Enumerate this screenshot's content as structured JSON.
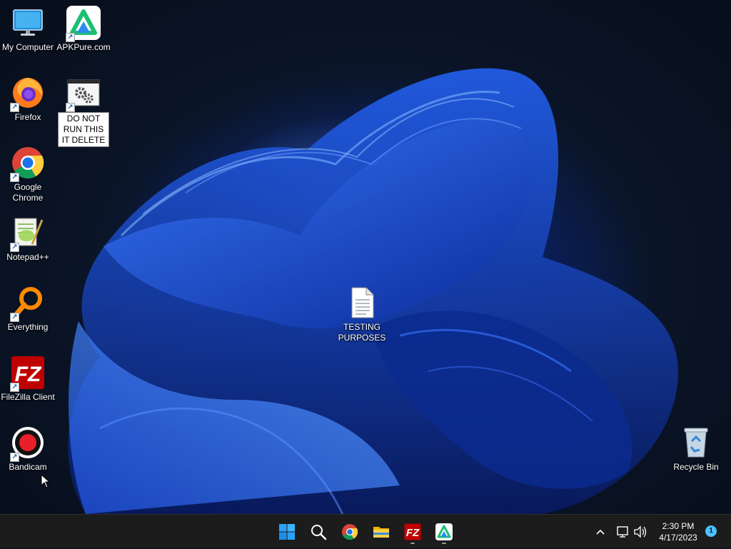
{
  "desktop": {
    "icons": {
      "my_computer": {
        "label": "My Computer",
        "icon": "monitor-icon"
      },
      "apkpure": {
        "label": "APKPure.com",
        "icon": "apkpure-icon"
      },
      "firefox": {
        "label": "Firefox",
        "icon": "firefox-icon"
      },
      "do_not_run": {
        "label": "DO NOT RUN THIS IT DELETE",
        "icon": "gear-icon"
      },
      "chrome": {
        "label": "Google Chrome",
        "icon": "chrome-icon"
      },
      "notepadpp": {
        "label": "Notepad++",
        "icon": "notepad-plus-plus-icon"
      },
      "everything": {
        "label": "Everything",
        "icon": "magnifier-icon"
      },
      "filezilla": {
        "label": "FileZilla Client",
        "icon": "filezilla-icon"
      },
      "bandicam": {
        "label": "Bandicam",
        "icon": "record-icon"
      },
      "testing": {
        "label": "TESTING PURPOSES",
        "icon": "text-document-icon"
      },
      "recycle_bin": {
        "label": "Recycle Bin",
        "icon": "recycle-bin-icon"
      }
    }
  },
  "taskbar": {
    "apps": [
      "start",
      "search",
      "chrome",
      "file-explorer",
      "filezilla",
      "apkpure"
    ],
    "clock": {
      "time": "2:30 PM",
      "date": "4/17/2023"
    },
    "notification_count": "1"
  },
  "colors": {
    "taskbar": "#1c1c1c",
    "accent": "#4cc2ff",
    "wallpaper": "#0d2f9a"
  }
}
